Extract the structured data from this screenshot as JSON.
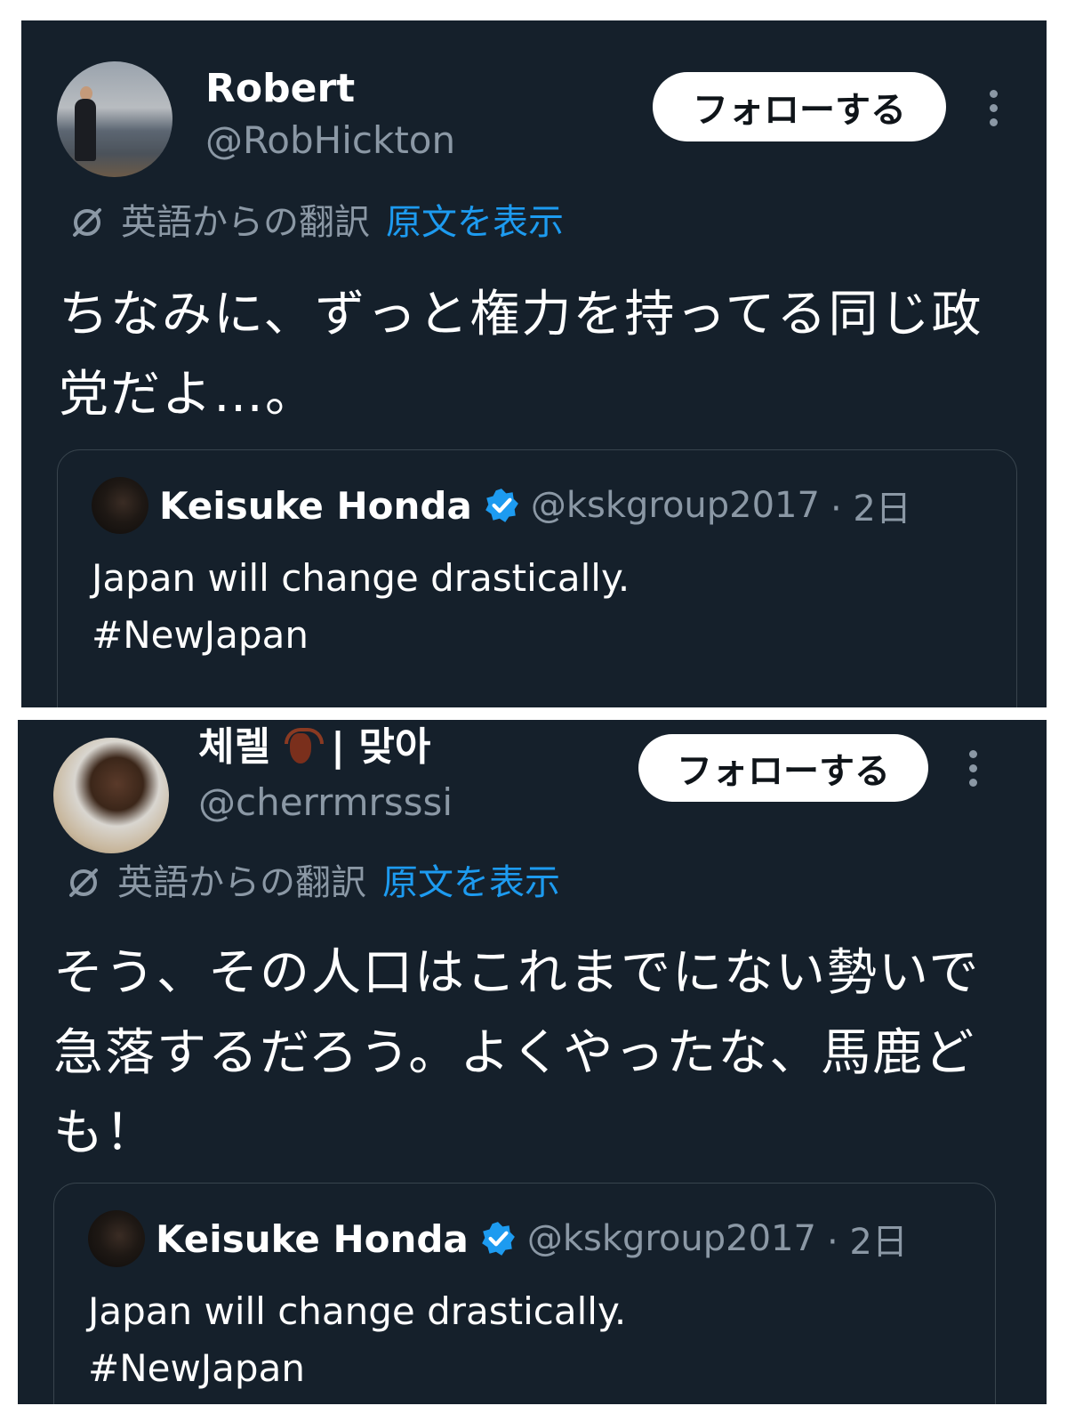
{
  "tweets": [
    {
      "display_name": "Robert",
      "handle": "@RobHickton",
      "follow_label": "フォローする",
      "translation_label": "英語からの翻訳",
      "show_original_label": "原文を表示",
      "text": "ちなみに、ずっと権力を持ってる同じ政\n党だよ…。",
      "quote": {
        "name": "Keisuke Honda",
        "handle": "@kskgroup2017",
        "date": "· 2日",
        "text": "Japan will change drastically.\n#NewJapan"
      }
    },
    {
      "display_name": "체렐",
      "display_name_suffix": "| 맞아",
      "emoji": "scorpion",
      "handle": "@cherrmrsssi",
      "follow_label": "フォローする",
      "translation_label": "英語からの翻訳",
      "show_original_label": "原文を表示",
      "text": "そう、その人口はこれまでにない勢いで\n急落するだろう。よくやったな、馬鹿ど\nも！",
      "quote": {
        "name": "Keisuke Honda",
        "handle": "@kskgroup2017",
        "date": "· 2日",
        "text": "Japan will change drastically.\n#NewJapan"
      }
    }
  ],
  "colors": {
    "background": "#15202b",
    "accent": "#1d9bf0",
    "secondary_text": "#8b98a5",
    "border": "#38444d"
  },
  "icons": [
    "translate-icon",
    "verified-badge-icon",
    "more-options-icon"
  ]
}
